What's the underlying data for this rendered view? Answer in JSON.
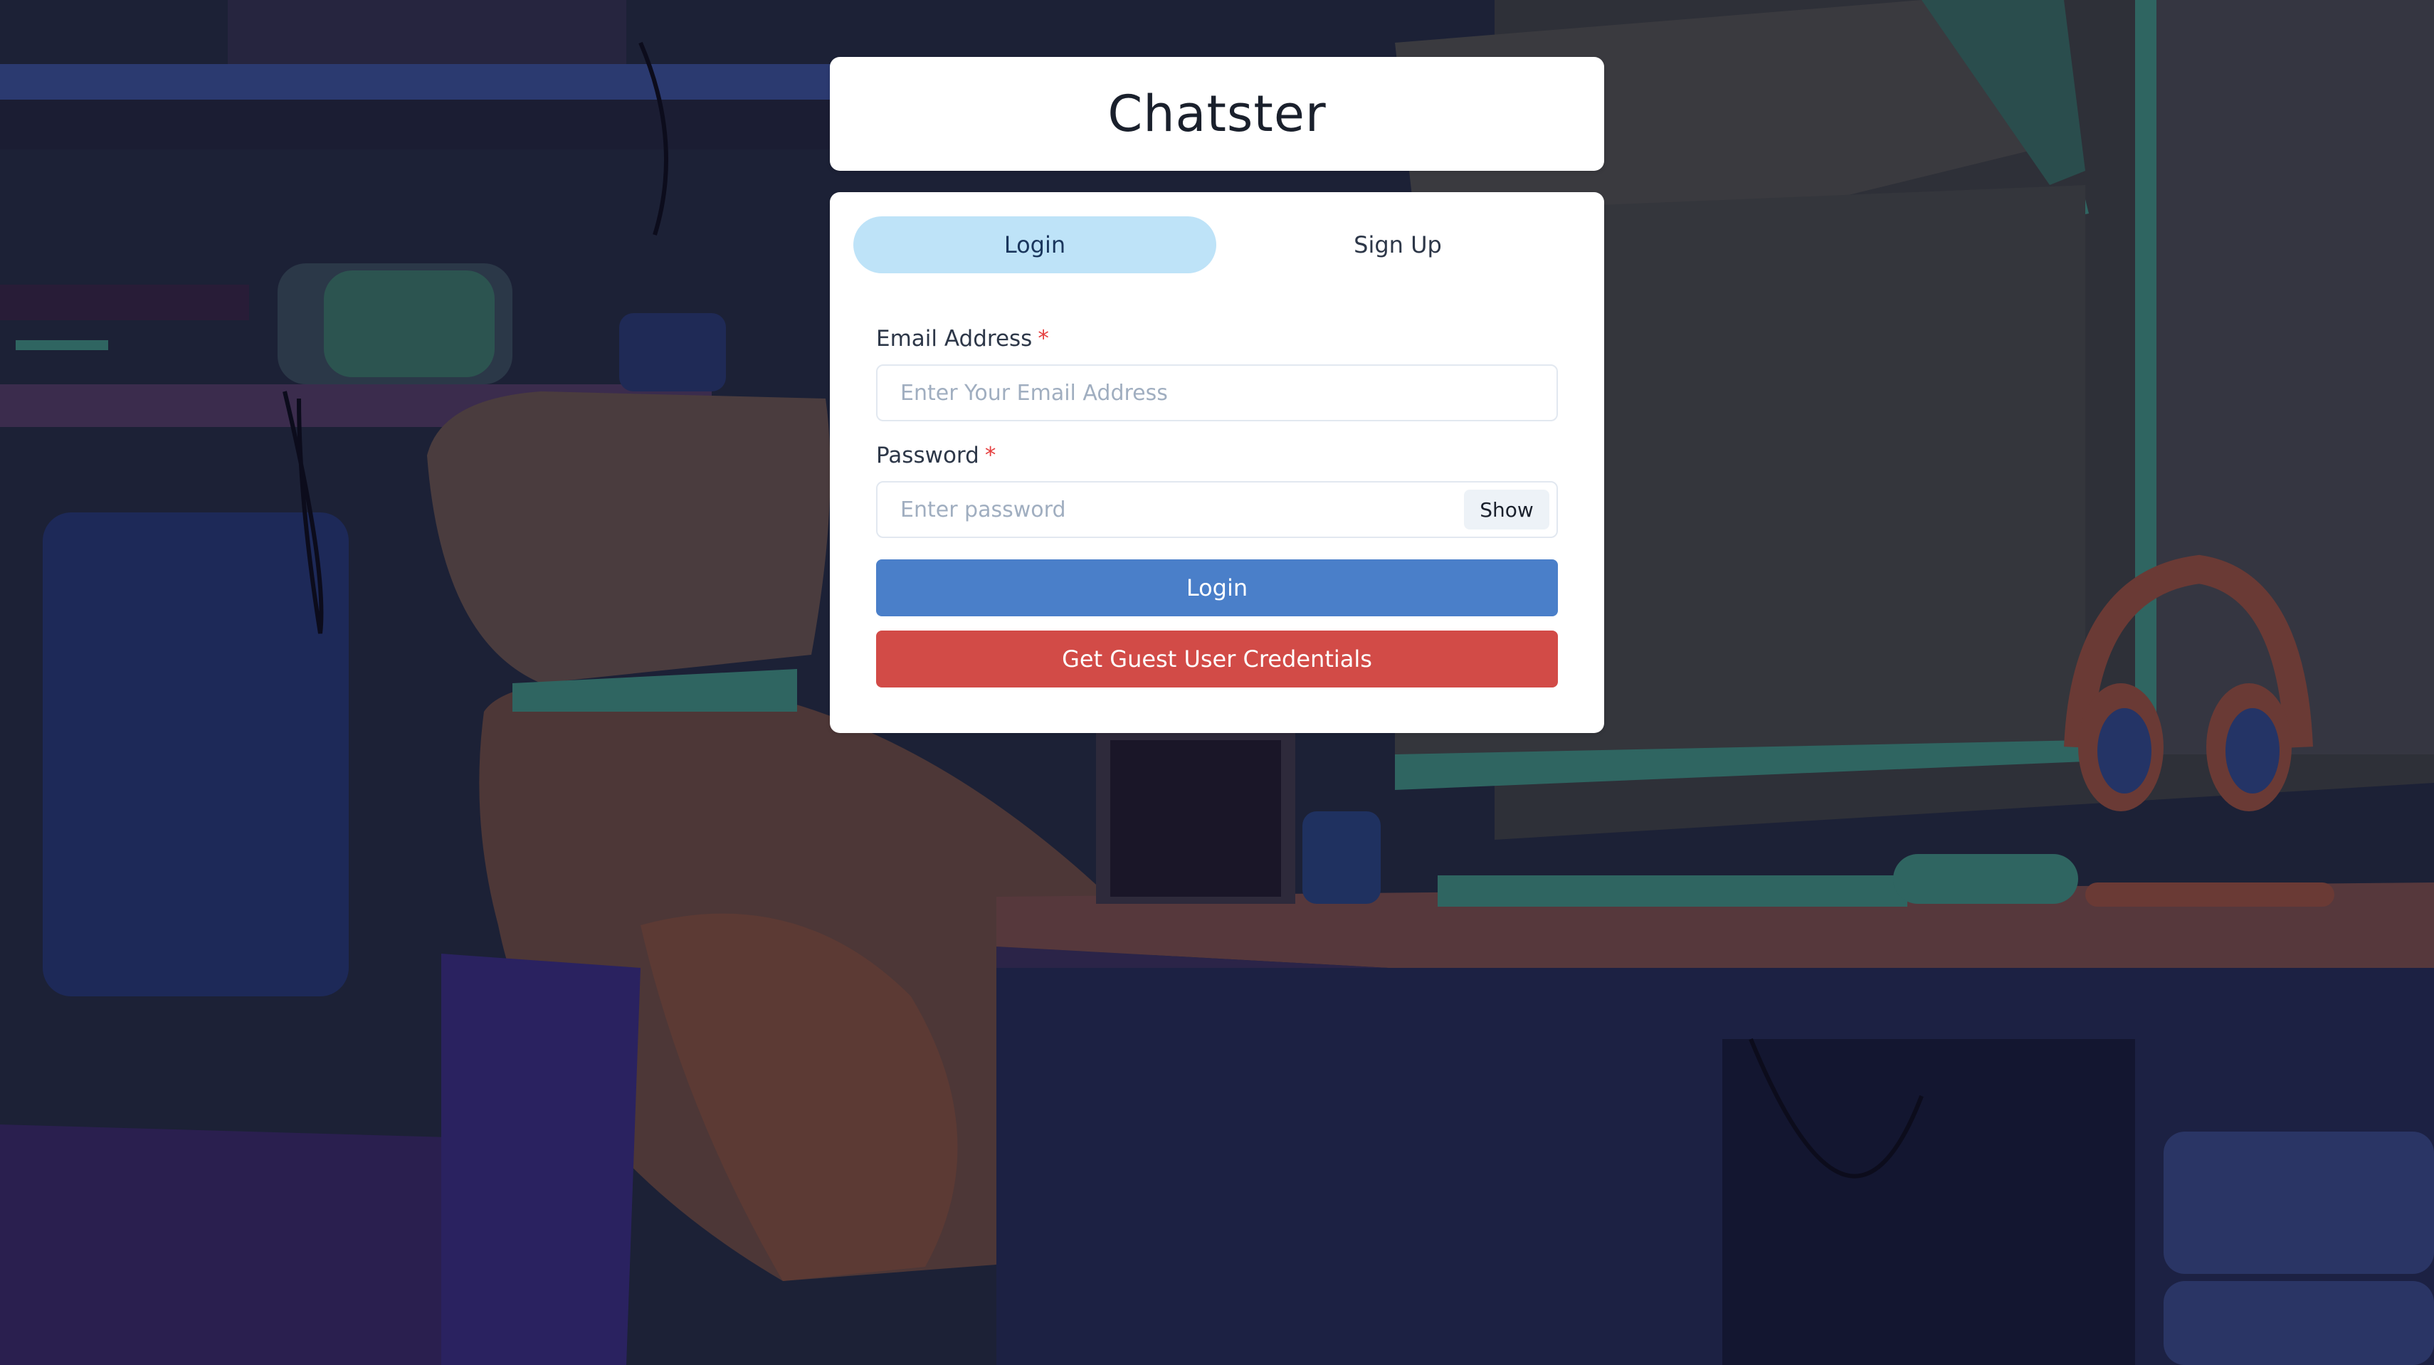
{
  "app": {
    "title": "Chatster"
  },
  "tabs": [
    {
      "label": "Login",
      "active": true
    },
    {
      "label": "Sign Up",
      "active": false
    }
  ],
  "form": {
    "email": {
      "label": "Email Address",
      "required_mark": "*",
      "placeholder": "Enter Your Email Address",
      "value": ""
    },
    "password": {
      "label": "Password",
      "required_mark": "*",
      "placeholder": "Enter password",
      "value": "",
      "toggle_label": "Show"
    },
    "login_button": "Login",
    "guest_button": "Get Guest User Credentials"
  },
  "colors": {
    "active_tab": "#bee3f8",
    "login_button": "#4a7fc9",
    "guest_button": "#d24b47",
    "required": "#e53e3e"
  }
}
